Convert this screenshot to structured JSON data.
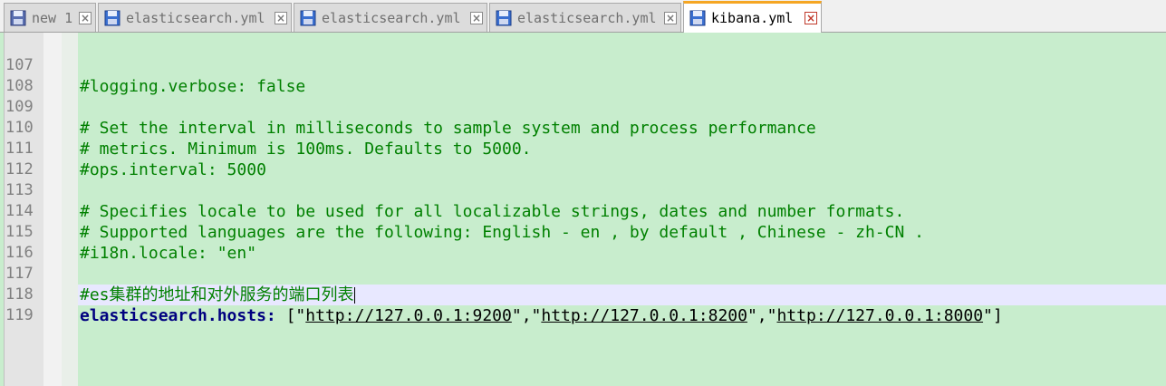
{
  "tabs": [
    {
      "label": "new 1",
      "active": false
    },
    {
      "label": "elasticsearch.yml",
      "active": false
    },
    {
      "label": "elasticsearch.yml",
      "active": false
    },
    {
      "label": "elasticsearch.yml",
      "active": false
    },
    {
      "label": "kibana.yml",
      "active": true
    }
  ],
  "editor": {
    "lines": [
      {
        "num": "107",
        "text": "#logging.verbose: false"
      },
      {
        "num": "108",
        "text": ""
      },
      {
        "num": "109",
        "text": "# Set the interval in milliseconds to sample system and process performance"
      },
      {
        "num": "110",
        "text": "# metrics. Minimum is 100ms. Defaults to 5000."
      },
      {
        "num": "111",
        "text": "#ops.interval: 5000"
      },
      {
        "num": "112",
        "text": ""
      },
      {
        "num": "113",
        "text": "# Specifies locale to be used for all localizable strings, dates and number formats."
      },
      {
        "num": "114",
        "text": "# Supported languages are the following: English - en , by default , Chinese - zh-CN ."
      },
      {
        "num": "115",
        "text": "#i18n.locale: \"en\""
      },
      {
        "num": "116",
        "text": ""
      },
      {
        "num": "117",
        "text": "#es集群的地址和对外服务的端口列表"
      },
      {
        "num": "118",
        "key": "elasticsearch.hosts",
        "colon": ": ",
        "open": "[\"",
        "url1": "http://127.0.0.1:9200",
        "sep1": "\",\"",
        "url2": "http://127.0.0.1:8200",
        "sep2": "\",\"",
        "url3": "http://127.0.0.1:8000",
        "close": "\"]"
      },
      {
        "num": "119",
        "text": ""
      }
    ]
  },
  "colors": {
    "background": "#c8edcd",
    "comment": "#008000",
    "key": "#000080",
    "accent_tab": "#f5a623"
  },
  "icons": {
    "tab_status": "floppy-disk-icon",
    "tab_close": "close-icon"
  }
}
